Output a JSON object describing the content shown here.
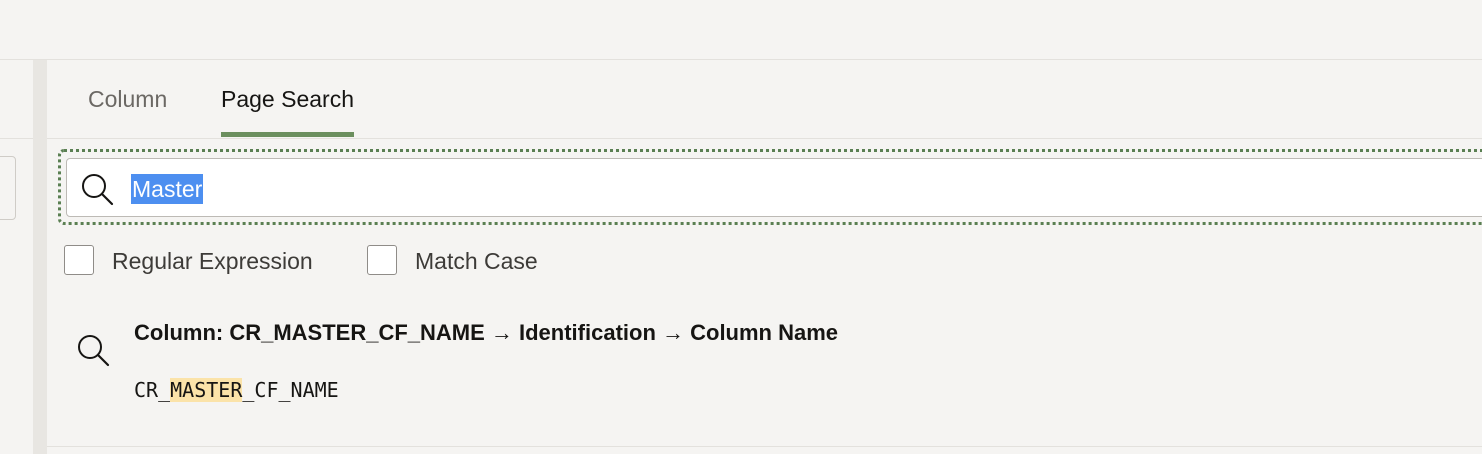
{
  "tabs": [
    {
      "label": "Column",
      "active": false
    },
    {
      "label": "Page Search",
      "active": true
    }
  ],
  "search": {
    "value": "Master",
    "value_selected": true
  },
  "options": {
    "regex_label": "Regular Expression",
    "regex_checked": false,
    "match_case_label": "Match Case",
    "match_case_checked": false
  },
  "results": [
    {
      "title": "Column: CR_MASTER_CF_NAME → Identification → Column Name",
      "snippet_before": "CR_",
      "snippet_match": "MASTER",
      "snippet_after": "_CF_NAME",
      "icon": "search-icon"
    }
  ],
  "colors": {
    "accent": "#6b8f5e",
    "selection": "#4d8ff0",
    "highlight": "#fbe3a9"
  }
}
